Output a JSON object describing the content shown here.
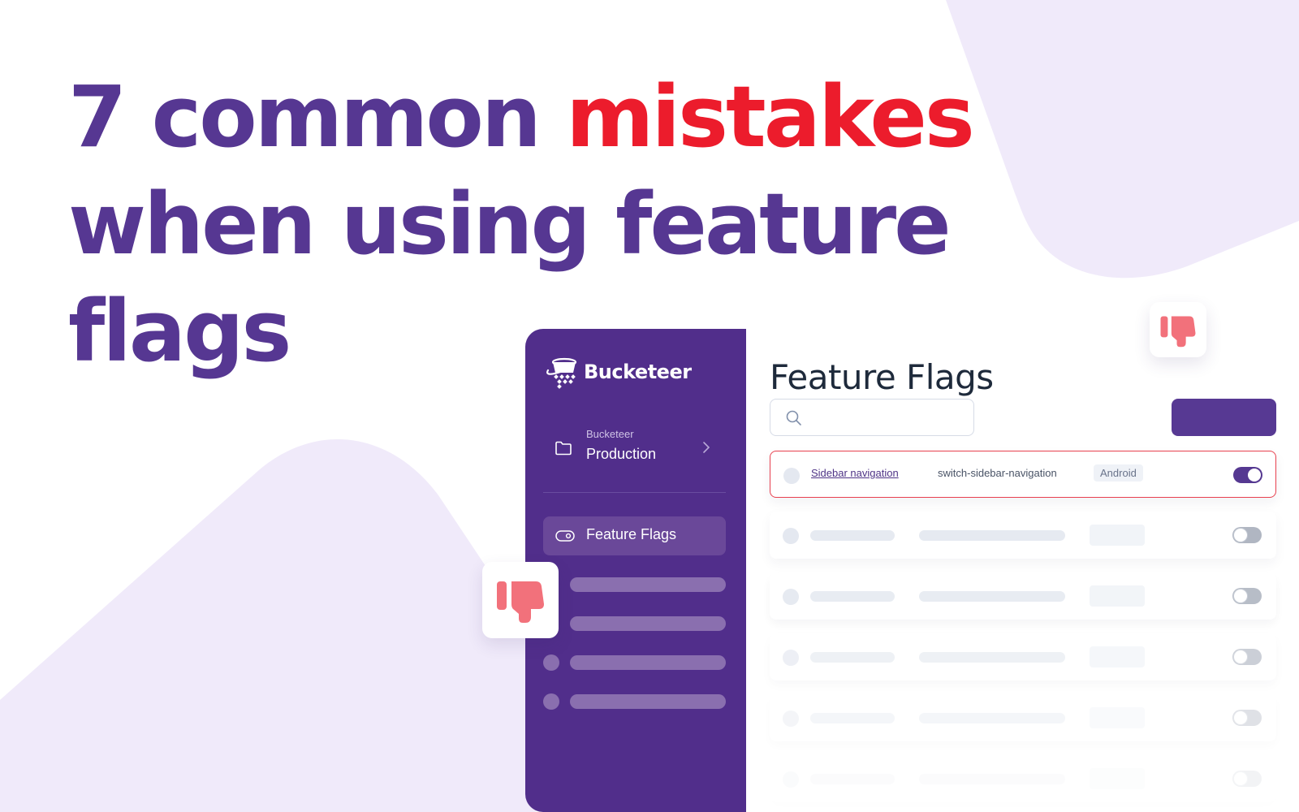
{
  "colors": {
    "headline": "#563792",
    "headline_accent": "#ec1c2c",
    "background_shape": "#f0eafa",
    "sidebar": "#512e8b",
    "sidebar_skeleton": "#8a6faf",
    "thumbs_down": "#f2717b",
    "primary_button": "#573993",
    "highlight_border": "#e8414f"
  },
  "headline": {
    "number": "7",
    "word_common": "common",
    "word_accent": "mistakes",
    "line2": "when using feature",
    "line3": "flags"
  },
  "sidebar": {
    "brand_name": "Bucketeer",
    "logo_icon": "bucket-logo-icon",
    "environment": {
      "label": "Bucketeer",
      "value": "Production",
      "icon": "folder-icon",
      "chevron": "chevron-right-icon"
    },
    "nav_active": {
      "label": "Feature Flags",
      "icon": "toggle-icon"
    },
    "skeleton_items": 4
  },
  "main": {
    "title": "Feature Flags",
    "search": {
      "placeholder": "",
      "value": ""
    },
    "primary_button_label": "",
    "flags": [
      {
        "name": "Sidebar navigation",
        "id": "switch-sidebar-navigation",
        "tag": "Android",
        "enabled": true,
        "highlighted": true
      }
    ],
    "placeholder_rows": [
      {
        "enabled": false
      },
      {
        "enabled": false
      },
      {
        "enabled": false
      },
      {
        "enabled": false
      },
      {
        "enabled": false
      }
    ]
  },
  "decorations": {
    "thumbs_down_icon": "thumbs-down-icon",
    "thumbs_down_count": 2
  }
}
